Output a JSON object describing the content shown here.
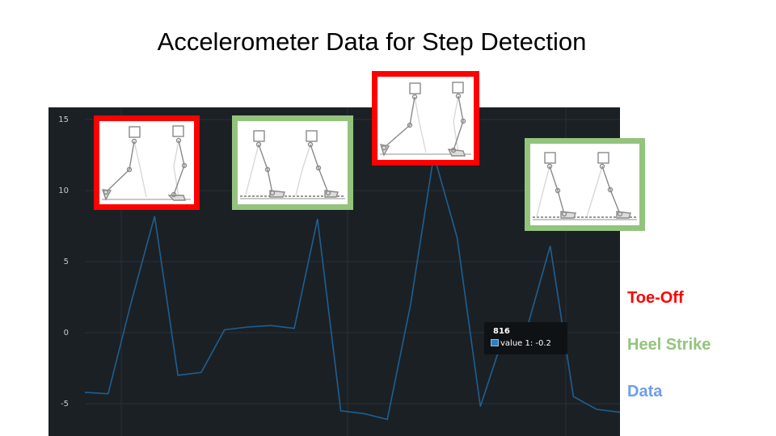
{
  "slide": {
    "title": "Accelerometer Data for Step Detection"
  },
  "legend": {
    "toe_off": "Toe-Off",
    "heel_strike": "Heel Strike",
    "data": "Data",
    "toe_off_color": "#ff0000",
    "heel_strike_color": "#93c47d",
    "data_color": "#6d9eeb"
  },
  "tooltip": {
    "x_label": "816",
    "series_text": "value 1: -0.2",
    "marker_color": "#2f7fc1"
  },
  "insets": [
    {
      "kind": "toe-off",
      "color": "#ff0000"
    },
    {
      "kind": "heel-strike",
      "color": "#93c47d"
    },
    {
      "kind": "toe-off",
      "color": "#ff0000"
    },
    {
      "kind": "heel-strike",
      "color": "#93c47d"
    }
  ],
  "chart_data": {
    "type": "line",
    "background": "#1b2025",
    "line_color": "#1f5f8f",
    "grid": true,
    "ylim": [
      -7,
      15.5
    ],
    "y_ticks": [
      15,
      10,
      5,
      0,
      -5
    ],
    "y_tick_labels": [
      "15",
      "10",
      "5",
      "0",
      "-5"
    ],
    "series": [
      {
        "values": [
          -4.2,
          -4.3,
          2.2,
          8.2,
          -3.0,
          -2.8,
          0.2,
          0.4,
          0.5,
          0.3,
          8.0,
          -5.5,
          -5.7,
          -6.1,
          2.0,
          12.5,
          6.7,
          -5.2,
          -0.2,
          0.3,
          6.1,
          -4.5,
          -5.4,
          -5.6
        ]
      }
    ],
    "highlight": {
      "index": 18,
      "value": -0.2
    }
  }
}
